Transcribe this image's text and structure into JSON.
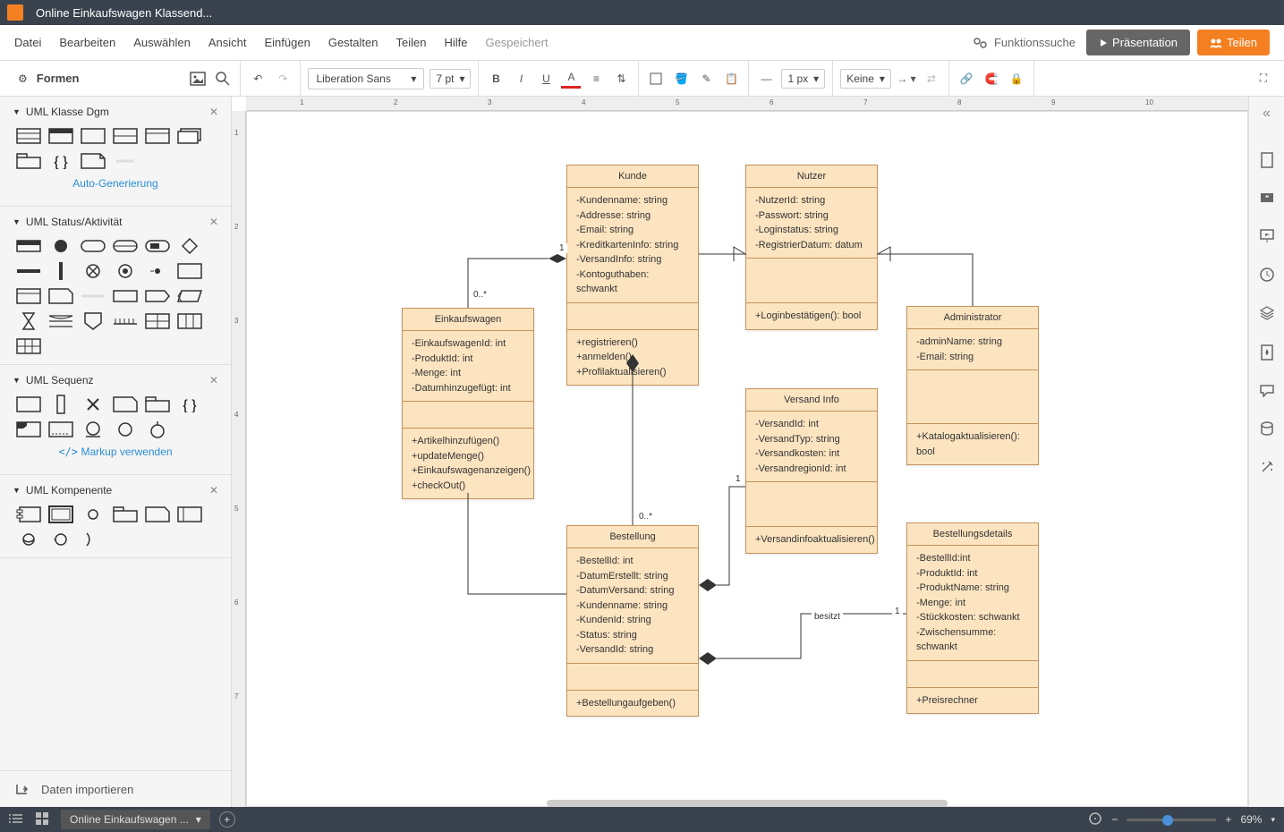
{
  "title": "Online Einkaufswagen Klassend...",
  "menu": {
    "items": [
      "Datei",
      "Bearbeiten",
      "Auswählen",
      "Ansicht",
      "Einfügen",
      "Gestalten",
      "Teilen",
      "Hilfe"
    ],
    "saved": "Gespeichert",
    "search": "Funktionssuche",
    "present": "Präsentation",
    "share": "Teilen"
  },
  "toolbar": {
    "font": "Liberation Sans",
    "size": "7 pt",
    "stroke": "1 px",
    "endpoint": "Keine"
  },
  "sidebar": {
    "title": "Formen",
    "groups": [
      {
        "name": "UML Klasse Dgm",
        "link": "Auto-Generierung"
      },
      {
        "name": "UML Status/Aktivität"
      },
      {
        "name": "UML Sequenz",
        "link": "Markup verwenden"
      },
      {
        "name": "UML Kompenente"
      }
    ],
    "import": "Daten importieren"
  },
  "uml": {
    "kunde": {
      "title": "Kunde",
      "attrs": "-Kundenname: string\n-Addresse: string\n-Email: string\n-KreditkartenInfo: string\n-VersandInfo: string\n-Kontoguthaben: schwankt",
      "ops": "+registrieren()\n+anmelden()\n+Profilaktualisieren()"
    },
    "nutzer": {
      "title": "Nutzer",
      "attrs": "-NutzerId: string\n-Passwort: string\n-Loginstatus: string\n-RegistrierDatum: datum",
      "ops": "+Loginbestätigen(): bool"
    },
    "einkaufswagen": {
      "title": "Einkaufswagen",
      "attrs": "-EinkaufswagenId: int\n-ProduktId: int\n-Menge: int\n-Datumhinzugefügt: int",
      "ops": "+Artikelhinzufügen()\n+updateMenge()\n+Einkaufswagenanzeigen()\n+checkOut()"
    },
    "admin": {
      "title": "Administrator",
      "attrs": "-adminName: string\n-Email: string",
      "ops": "+Katalogaktualisieren(): bool"
    },
    "versand": {
      "title": "Versand Info",
      "attrs": "-VersandId: int\n-VersandTyp: string\n-Versandkosten: int\n-VersandregionId: int",
      "ops": "+Versandinfoaktualisieren()"
    },
    "bestellung": {
      "title": "Bestellung",
      "attrs": "-BestellId: int\n-DatumErstellt: string\n-DatumVersand: string\n-Kundenname: string\n-KundenId: string\n-Status: string\n-VersandId: string",
      "ops": "+Bestellungaufgeben()"
    },
    "details": {
      "title": "Bestellungsdetails",
      "attrs": "-BestellId:int\n-ProduktId: int\n-ProduktName: string\n-Menge: int\n-Stückkosten: schwankt\n-Zwischensumme: schwankt",
      "ops": "+Preisrechner"
    }
  },
  "labels": {
    "zeroMany": "0..*",
    "one": "1",
    "besitzt": "besitzt"
  },
  "footer": {
    "tab": "Online Einkaufswagen ...",
    "zoom": "69%"
  }
}
